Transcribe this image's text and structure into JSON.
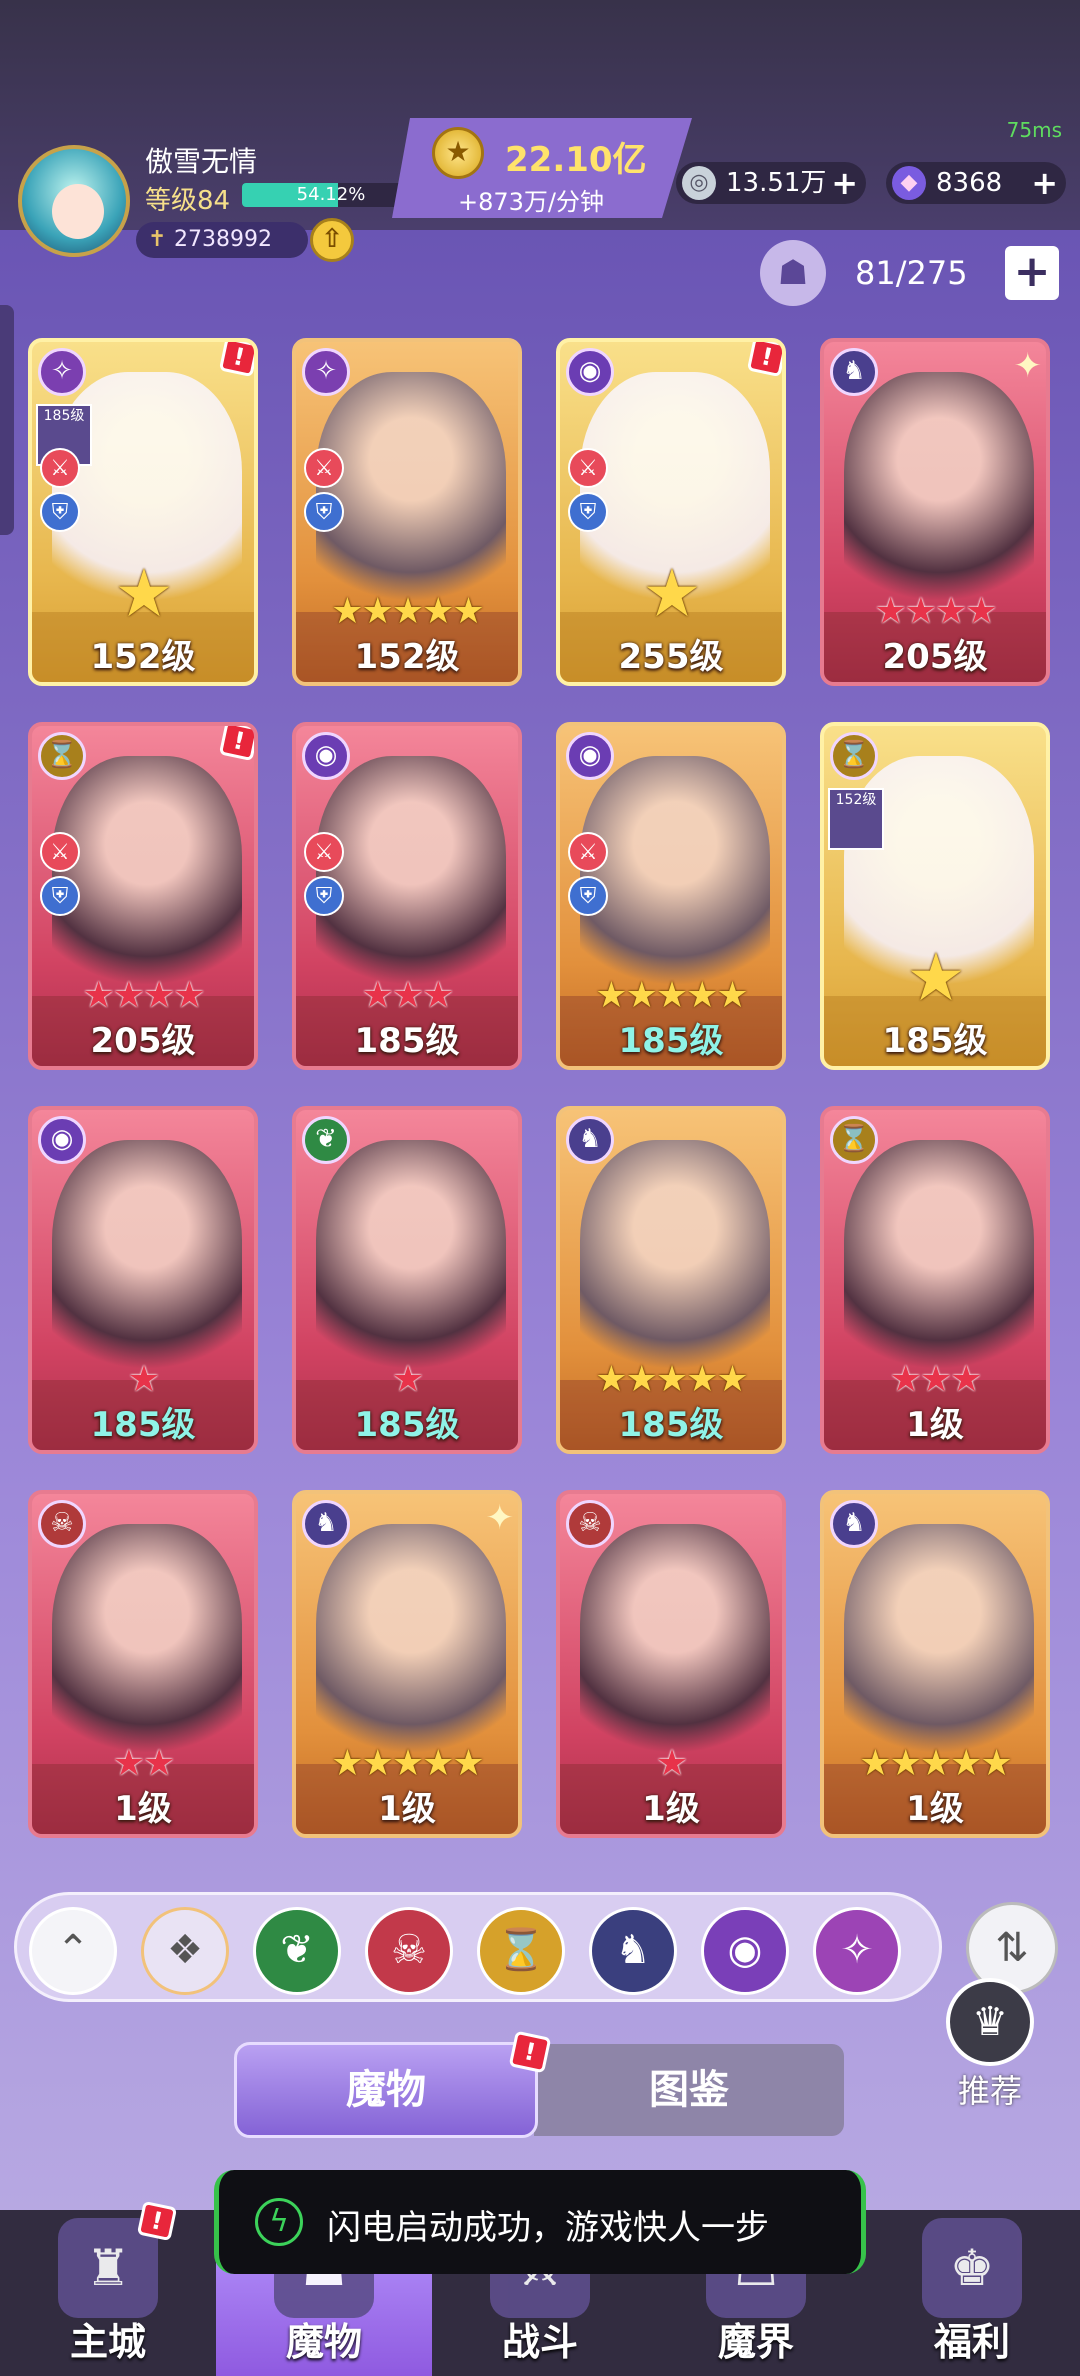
{
  "status": {
    "ping": "75ms"
  },
  "player": {
    "name": "傲雪无情",
    "level_label": "等级84",
    "xp_percent_text": "54.12%",
    "xp_fraction": 0.5412,
    "power": "2738992"
  },
  "currency": {
    "gold_amount": "22.10亿",
    "gold_rate": "+873万/分钟",
    "silver": "13.51万",
    "gems": "8368",
    "plus": "+"
  },
  "capacity": {
    "text": "81/275",
    "plus": "+"
  },
  "cards": [
    {
      "level": "152级",
      "stars": 1,
      "star_color": "gold",
      "frame": "gold",
      "faction": "swirl",
      "alert": true,
      "mini_label": "185级"
    },
    {
      "level": "152级",
      "stars": 5,
      "star_color": "gold",
      "frame": "orange",
      "faction": "swirl",
      "alert": false
    },
    {
      "level": "255级",
      "stars": 1,
      "star_color": "gold",
      "frame": "gold",
      "faction": "eye",
      "alert": true
    },
    {
      "level": "205级",
      "stars": 4,
      "star_color": "red",
      "frame": "red",
      "faction": "dragon",
      "alert": false,
      "sparkle": true
    },
    {
      "level": "205级",
      "stars": 4,
      "star_color": "red",
      "frame": "red",
      "faction": "hourglass",
      "alert": true
    },
    {
      "level": "185级",
      "stars": 3,
      "star_color": "red",
      "frame": "red",
      "faction": "eye",
      "alert": false
    },
    {
      "level": "185级",
      "stars": 5,
      "star_color": "gold",
      "frame": "orange",
      "faction": "eye",
      "alert": false,
      "teal": true
    },
    {
      "level": "185级",
      "stars": 1,
      "star_color": "gold",
      "frame": "gold",
      "faction": "hourglass",
      "alert": false,
      "mini_label": "152级"
    },
    {
      "level": "185级",
      "stars": 1,
      "star_color": "red",
      "frame": "red",
      "faction": "eye",
      "alert": false,
      "teal": true
    },
    {
      "level": "185级",
      "stars": 1,
      "star_color": "red",
      "frame": "red",
      "faction": "leaf",
      "alert": false,
      "teal": true
    },
    {
      "level": "185级",
      "stars": 5,
      "star_color": "gold",
      "frame": "orange",
      "faction": "dragon",
      "alert": false,
      "teal": true
    },
    {
      "level": "1级",
      "stars": 3,
      "star_color": "red",
      "frame": "red",
      "faction": "hourglass",
      "alert": false
    },
    {
      "level": "1级",
      "stars": 2,
      "star_color": "red",
      "frame": "red",
      "faction": "demon",
      "alert": false
    },
    {
      "level": "1级",
      "stars": 5,
      "star_color": "gold",
      "frame": "orange",
      "faction": "dragon",
      "alert": false,
      "sparkle": true
    },
    {
      "level": "1级",
      "stars": 1,
      "star_color": "red",
      "frame": "red",
      "faction": "demon",
      "alert": false
    },
    {
      "level": "1级",
      "stars": 5,
      "star_color": "gold",
      "frame": "orange",
      "faction": "dragon",
      "alert": false
    }
  ],
  "filters": [
    {
      "name": "collapse",
      "icon": "⌃"
    },
    {
      "name": "all",
      "icon": "❖"
    },
    {
      "name": "leaf",
      "icon": "❦"
    },
    {
      "name": "demon",
      "icon": "☠"
    },
    {
      "name": "hourglass",
      "icon": "⌛"
    },
    {
      "name": "dragon",
      "icon": "♞"
    },
    {
      "name": "eye",
      "icon": "◉"
    },
    {
      "name": "swirl",
      "icon": "✧"
    }
  ],
  "tabs": {
    "monsters": "魔物",
    "codex": "图鉴"
  },
  "recommend": "推荐",
  "toast": "闪电启动成功，游戏快人一步",
  "nav": [
    {
      "label": "主城",
      "alert": true
    },
    {
      "label": "魔物",
      "active": true
    },
    {
      "label": "战斗"
    },
    {
      "label": "魔界"
    },
    {
      "label": "福利"
    }
  ]
}
